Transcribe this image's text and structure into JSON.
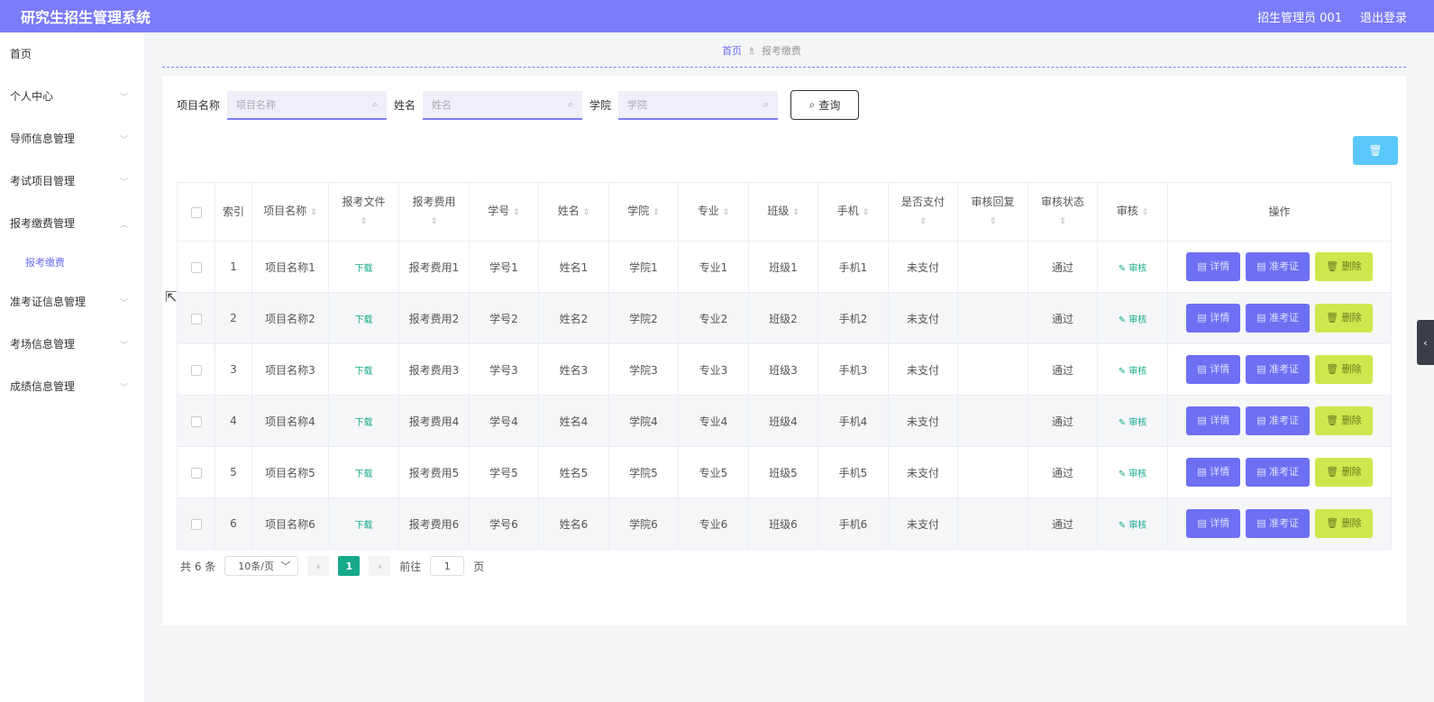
{
  "header": {
    "title": "研究生招生管理系统",
    "user": "招生管理员 001",
    "logout": "退出登录",
    "bg_color": "#7b7cf7"
  },
  "sidebar": {
    "items": [
      {
        "label": "首页",
        "chevron": ""
      },
      {
        "label": "个人中心",
        "chevron": "﹀"
      },
      {
        "label": "导师信息管理",
        "chevron": "﹀"
      },
      {
        "label": "考试项目管理",
        "chevron": "﹀"
      },
      {
        "label": "报考缴费管理",
        "chevron": "︿"
      },
      {
        "label": "准考证信息管理",
        "chevron": "﹀"
      },
      {
        "label": "考场信息管理",
        "chevron": "﹀"
      },
      {
        "label": "成绩信息管理",
        "chevron": "﹀"
      }
    ],
    "active_sub": "报考缴费"
  },
  "breadcrumb": {
    "home": "首页",
    "sep": "♗",
    "current": "报考缴费"
  },
  "search": {
    "fields": [
      {
        "label": "项目名称",
        "placeholder": "项目名称"
      },
      {
        "label": "姓名",
        "placeholder": "姓名"
      },
      {
        "label": "学院",
        "placeholder": "学院"
      }
    ],
    "button": "查询"
  },
  "table": {
    "columns": [
      "索引",
      "项目名称",
      "报考文件",
      "报考费用",
      "学号",
      "姓名",
      "学院",
      "专业",
      "班级",
      "手机",
      "是否支付",
      "审核回复",
      "审核状态",
      "审核",
      "操作"
    ],
    "rows": [
      {
        "idx": "1",
        "project": "项目名称1",
        "file": "下载",
        "fee": "报考费用1",
        "sid": "学号1",
        "name": "姓名1",
        "college": "学院1",
        "major": "专业1",
        "cls": "班级1",
        "phone": "手机1",
        "paid": "未支付",
        "reply": "",
        "status": "通过",
        "audit": "审核"
      },
      {
        "idx": "2",
        "project": "项目名称2",
        "file": "下载",
        "fee": "报考费用2",
        "sid": "学号2",
        "name": "姓名2",
        "college": "学院2",
        "major": "专业2",
        "cls": "班级2",
        "phone": "手机2",
        "paid": "未支付",
        "reply": "",
        "status": "通过",
        "audit": "审核"
      },
      {
        "idx": "3",
        "project": "项目名称3",
        "file": "下载",
        "fee": "报考费用3",
        "sid": "学号3",
        "name": "姓名3",
        "college": "学院3",
        "major": "专业3",
        "cls": "班级3",
        "phone": "手机3",
        "paid": "未支付",
        "reply": "",
        "status": "通过",
        "audit": "审核"
      },
      {
        "idx": "4",
        "project": "项目名称4",
        "file": "下载",
        "fee": "报考费用4",
        "sid": "学号4",
        "name": "姓名4",
        "college": "学院4",
        "major": "专业4",
        "cls": "班级4",
        "phone": "手机4",
        "paid": "未支付",
        "reply": "",
        "status": "通过",
        "audit": "审核"
      },
      {
        "idx": "5",
        "project": "项目名称5",
        "file": "下载",
        "fee": "报考费用5",
        "sid": "学号5",
        "name": "姓名5",
        "college": "学院5",
        "major": "专业5",
        "cls": "班级5",
        "phone": "手机5",
        "paid": "未支付",
        "reply": "",
        "status": "通过",
        "audit": "审核"
      },
      {
        "idx": "6",
        "project": "项目名称6",
        "file": "下载",
        "fee": "报考费用6",
        "sid": "学号6",
        "name": "姓名6",
        "college": "学院6",
        "major": "专业6",
        "cls": "班级6",
        "phone": "手机6",
        "paid": "未支付",
        "reply": "",
        "status": "通过",
        "audit": "审核"
      }
    ],
    "actions": {
      "detail": "详情",
      "ticket": "准考证",
      "remove": "删除"
    }
  },
  "pager": {
    "total": "共 6 条",
    "size": "10条/页",
    "current": "1",
    "goto": "前往",
    "goto_value": "1",
    "page": "页"
  },
  "colors": {
    "primary": "#7b7cf7",
    "green": "#16a98a",
    "lime": "#cde84d",
    "sky": "#5ac8fa"
  }
}
